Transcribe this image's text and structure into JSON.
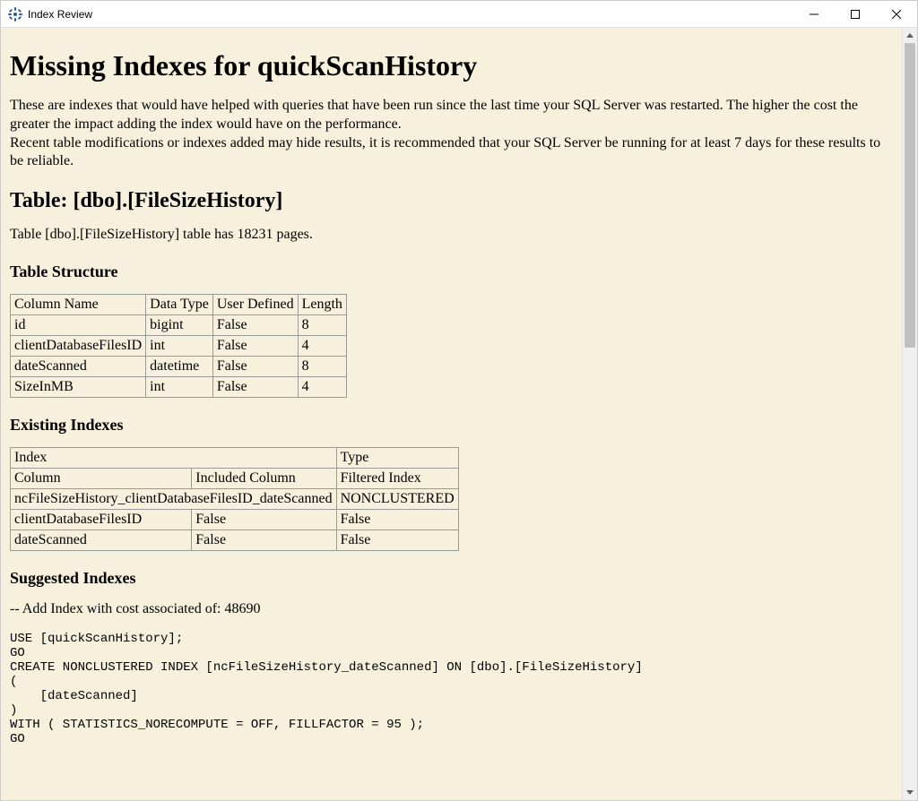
{
  "window": {
    "title": "Index Review"
  },
  "page": {
    "heading": "Missing Indexes for quickScanHistory",
    "intro1": "These are indexes that would have helped with queries that have been run since the last time your SQL Server was restarted. The higher the cost the greater the impact adding the index would have on the performance.",
    "intro2": "Recent table modifications or indexes added may hide results, it is recommended that your SQL Server be running for at least 7 days for these results to be reliable."
  },
  "table_section": {
    "heading": "Table: [dbo].[FileSizeHistory]",
    "pages_line": "Table [dbo].[FileSizeHistory] table has 18231 pages."
  },
  "structure": {
    "heading": "Table Structure",
    "headers": {
      "col0": "Column Name",
      "col1": "Data Type",
      "col2": "User Defined",
      "col3": "Length"
    },
    "rows": {
      "r0": {
        "name": "id",
        "dtype": "bigint",
        "udef": "False",
        "len": "8"
      },
      "r1": {
        "name": "clientDatabaseFilesID",
        "dtype": "int",
        "udef": "False",
        "len": "4"
      },
      "r2": {
        "name": "dateScanned",
        "dtype": "datetime",
        "udef": "False",
        "len": "8"
      },
      "r3": {
        "name": "SizeInMB",
        "dtype": "int",
        "udef": "False",
        "len": "4"
      }
    }
  },
  "existing": {
    "heading": "Existing Indexes",
    "headers": {
      "h0": "Index",
      "h1": "Type",
      "h2": "Column",
      "h3": "Included Column",
      "h4": "Filtered Index"
    },
    "idx_name": "ncFileSizeHistory_clientDatabaseFilesID_dateScanned",
    "idx_type": "NONCLUSTERED",
    "rows": {
      "r0": {
        "col": "clientDatabaseFilesID",
        "inc": "False",
        "filt": "False"
      },
      "r1": {
        "col": "dateScanned",
        "inc": "False",
        "filt": "False"
      }
    }
  },
  "suggested": {
    "heading": "Suggested Indexes",
    "cost_line": "-- Add Index with cost associated of: 48690",
    "sql": "USE [quickScanHistory];\nGO\nCREATE NONCLUSTERED INDEX [ncFileSizeHistory_dateScanned] ON [dbo].[FileSizeHistory]\n(\n    [dateScanned]\n)\nWITH ( STATISTICS_NORECOMPUTE = OFF, FILLFACTOR = 95 );\nGO"
  }
}
